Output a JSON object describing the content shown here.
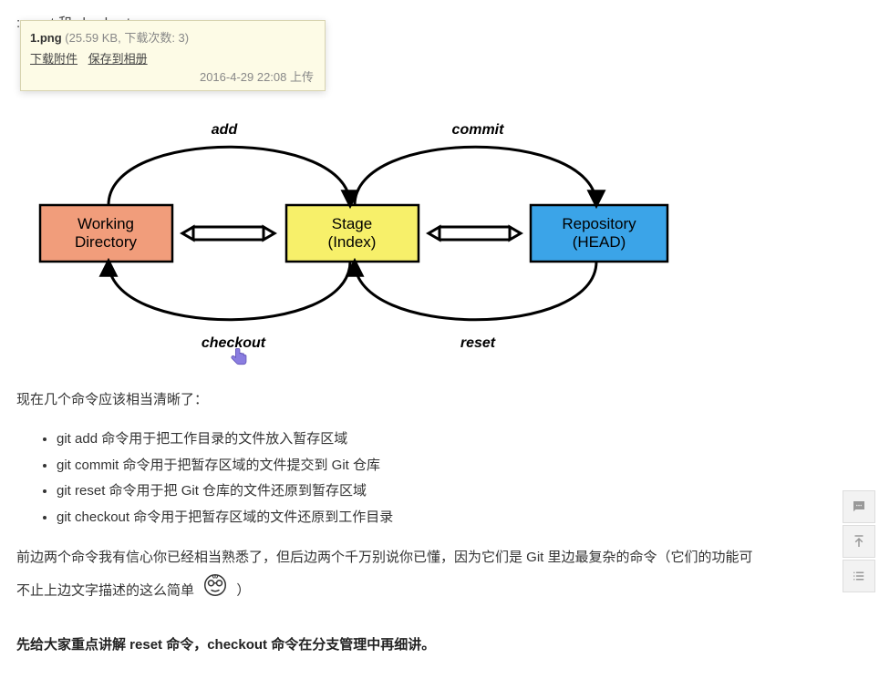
{
  "top_line_suffix": ": reset 和 checkout",
  "tooltip": {
    "filename": "1.png",
    "meta": " (25.59 KB, 下载次数: 3)",
    "link_download": "下载附件",
    "link_save": "保存到相册",
    "date": "2016-4-29 22:08 上传"
  },
  "diagram": {
    "box1_line1": "Working",
    "box1_line2": "Directory",
    "box2_line1": "Stage",
    "box2_line2": "(Index)",
    "box3_line1": "Repository",
    "box3_line2": "(HEAD)",
    "label_add": "add",
    "label_commit": "commit",
    "label_checkout": "checkout",
    "label_reset": "reset"
  },
  "para1": "现在几个命令应该相当清晰了：",
  "commands": [
    "git add 命令用于把工作目录的文件放入暂存区域",
    "git commit 命令用于把暂存区域的文件提交到 Git 仓库",
    "git reset 命令用于把 Git 仓库的文件还原到暂存区域",
    "git checkout 命令用于把暂存区域的文件还原到工作目录"
  ],
  "para2a": "前边两个命令我有信心你已经相当熟悉了，但后边两个千万别说你已懂，因为它们是 Git 里边最复杂的命令（它们的功能可",
  "para2b": "不止上边文字描述的这么简单",
  "para2c": "）",
  "para3": "先给大家重点讲解 reset 命令，checkout 命令在分支管理中再细讲。"
}
